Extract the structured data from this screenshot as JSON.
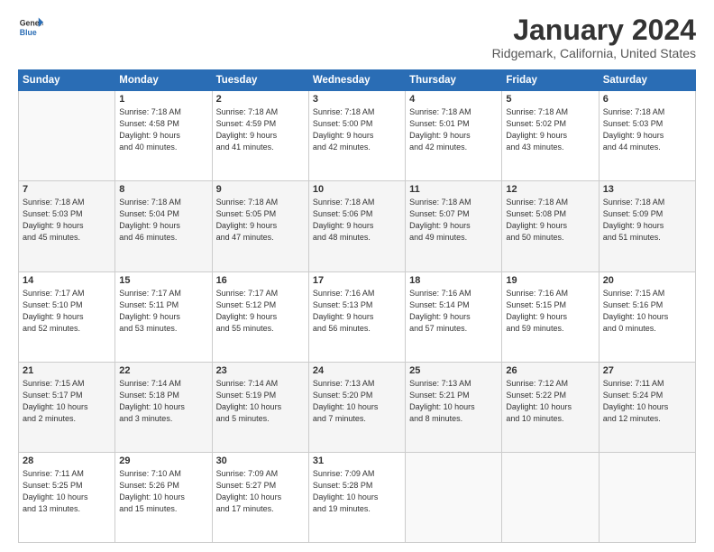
{
  "logo": {
    "line1": "General",
    "line2": "Blue"
  },
  "title": "January 2024",
  "location": "Ridgemark, California, United States",
  "days_of_week": [
    "Sunday",
    "Monday",
    "Tuesday",
    "Wednesday",
    "Thursday",
    "Friday",
    "Saturday"
  ],
  "weeks": [
    [
      {
        "day": "",
        "info": ""
      },
      {
        "day": "1",
        "info": "Sunrise: 7:18 AM\nSunset: 4:58 PM\nDaylight: 9 hours\nand 40 minutes."
      },
      {
        "day": "2",
        "info": "Sunrise: 7:18 AM\nSunset: 4:59 PM\nDaylight: 9 hours\nand 41 minutes."
      },
      {
        "day": "3",
        "info": "Sunrise: 7:18 AM\nSunset: 5:00 PM\nDaylight: 9 hours\nand 42 minutes."
      },
      {
        "day": "4",
        "info": "Sunrise: 7:18 AM\nSunset: 5:01 PM\nDaylight: 9 hours\nand 42 minutes."
      },
      {
        "day": "5",
        "info": "Sunrise: 7:18 AM\nSunset: 5:02 PM\nDaylight: 9 hours\nand 43 minutes."
      },
      {
        "day": "6",
        "info": "Sunrise: 7:18 AM\nSunset: 5:03 PM\nDaylight: 9 hours\nand 44 minutes."
      }
    ],
    [
      {
        "day": "7",
        "info": "Sunrise: 7:18 AM\nSunset: 5:03 PM\nDaylight: 9 hours\nand 45 minutes."
      },
      {
        "day": "8",
        "info": "Sunrise: 7:18 AM\nSunset: 5:04 PM\nDaylight: 9 hours\nand 46 minutes."
      },
      {
        "day": "9",
        "info": "Sunrise: 7:18 AM\nSunset: 5:05 PM\nDaylight: 9 hours\nand 47 minutes."
      },
      {
        "day": "10",
        "info": "Sunrise: 7:18 AM\nSunset: 5:06 PM\nDaylight: 9 hours\nand 48 minutes."
      },
      {
        "day": "11",
        "info": "Sunrise: 7:18 AM\nSunset: 5:07 PM\nDaylight: 9 hours\nand 49 minutes."
      },
      {
        "day": "12",
        "info": "Sunrise: 7:18 AM\nSunset: 5:08 PM\nDaylight: 9 hours\nand 50 minutes."
      },
      {
        "day": "13",
        "info": "Sunrise: 7:18 AM\nSunset: 5:09 PM\nDaylight: 9 hours\nand 51 minutes."
      }
    ],
    [
      {
        "day": "14",
        "info": "Sunrise: 7:17 AM\nSunset: 5:10 PM\nDaylight: 9 hours\nand 52 minutes."
      },
      {
        "day": "15",
        "info": "Sunrise: 7:17 AM\nSunset: 5:11 PM\nDaylight: 9 hours\nand 53 minutes."
      },
      {
        "day": "16",
        "info": "Sunrise: 7:17 AM\nSunset: 5:12 PM\nDaylight: 9 hours\nand 55 minutes."
      },
      {
        "day": "17",
        "info": "Sunrise: 7:16 AM\nSunset: 5:13 PM\nDaylight: 9 hours\nand 56 minutes."
      },
      {
        "day": "18",
        "info": "Sunrise: 7:16 AM\nSunset: 5:14 PM\nDaylight: 9 hours\nand 57 minutes."
      },
      {
        "day": "19",
        "info": "Sunrise: 7:16 AM\nSunset: 5:15 PM\nDaylight: 9 hours\nand 59 minutes."
      },
      {
        "day": "20",
        "info": "Sunrise: 7:15 AM\nSunset: 5:16 PM\nDaylight: 10 hours\nand 0 minutes."
      }
    ],
    [
      {
        "day": "21",
        "info": "Sunrise: 7:15 AM\nSunset: 5:17 PM\nDaylight: 10 hours\nand 2 minutes."
      },
      {
        "day": "22",
        "info": "Sunrise: 7:14 AM\nSunset: 5:18 PM\nDaylight: 10 hours\nand 3 minutes."
      },
      {
        "day": "23",
        "info": "Sunrise: 7:14 AM\nSunset: 5:19 PM\nDaylight: 10 hours\nand 5 minutes."
      },
      {
        "day": "24",
        "info": "Sunrise: 7:13 AM\nSunset: 5:20 PM\nDaylight: 10 hours\nand 7 minutes."
      },
      {
        "day": "25",
        "info": "Sunrise: 7:13 AM\nSunset: 5:21 PM\nDaylight: 10 hours\nand 8 minutes."
      },
      {
        "day": "26",
        "info": "Sunrise: 7:12 AM\nSunset: 5:22 PM\nDaylight: 10 hours\nand 10 minutes."
      },
      {
        "day": "27",
        "info": "Sunrise: 7:11 AM\nSunset: 5:24 PM\nDaylight: 10 hours\nand 12 minutes."
      }
    ],
    [
      {
        "day": "28",
        "info": "Sunrise: 7:11 AM\nSunset: 5:25 PM\nDaylight: 10 hours\nand 13 minutes."
      },
      {
        "day": "29",
        "info": "Sunrise: 7:10 AM\nSunset: 5:26 PM\nDaylight: 10 hours\nand 15 minutes."
      },
      {
        "day": "30",
        "info": "Sunrise: 7:09 AM\nSunset: 5:27 PM\nDaylight: 10 hours\nand 17 minutes."
      },
      {
        "day": "31",
        "info": "Sunrise: 7:09 AM\nSunset: 5:28 PM\nDaylight: 10 hours\nand 19 minutes."
      },
      {
        "day": "",
        "info": ""
      },
      {
        "day": "",
        "info": ""
      },
      {
        "day": "",
        "info": ""
      }
    ]
  ]
}
